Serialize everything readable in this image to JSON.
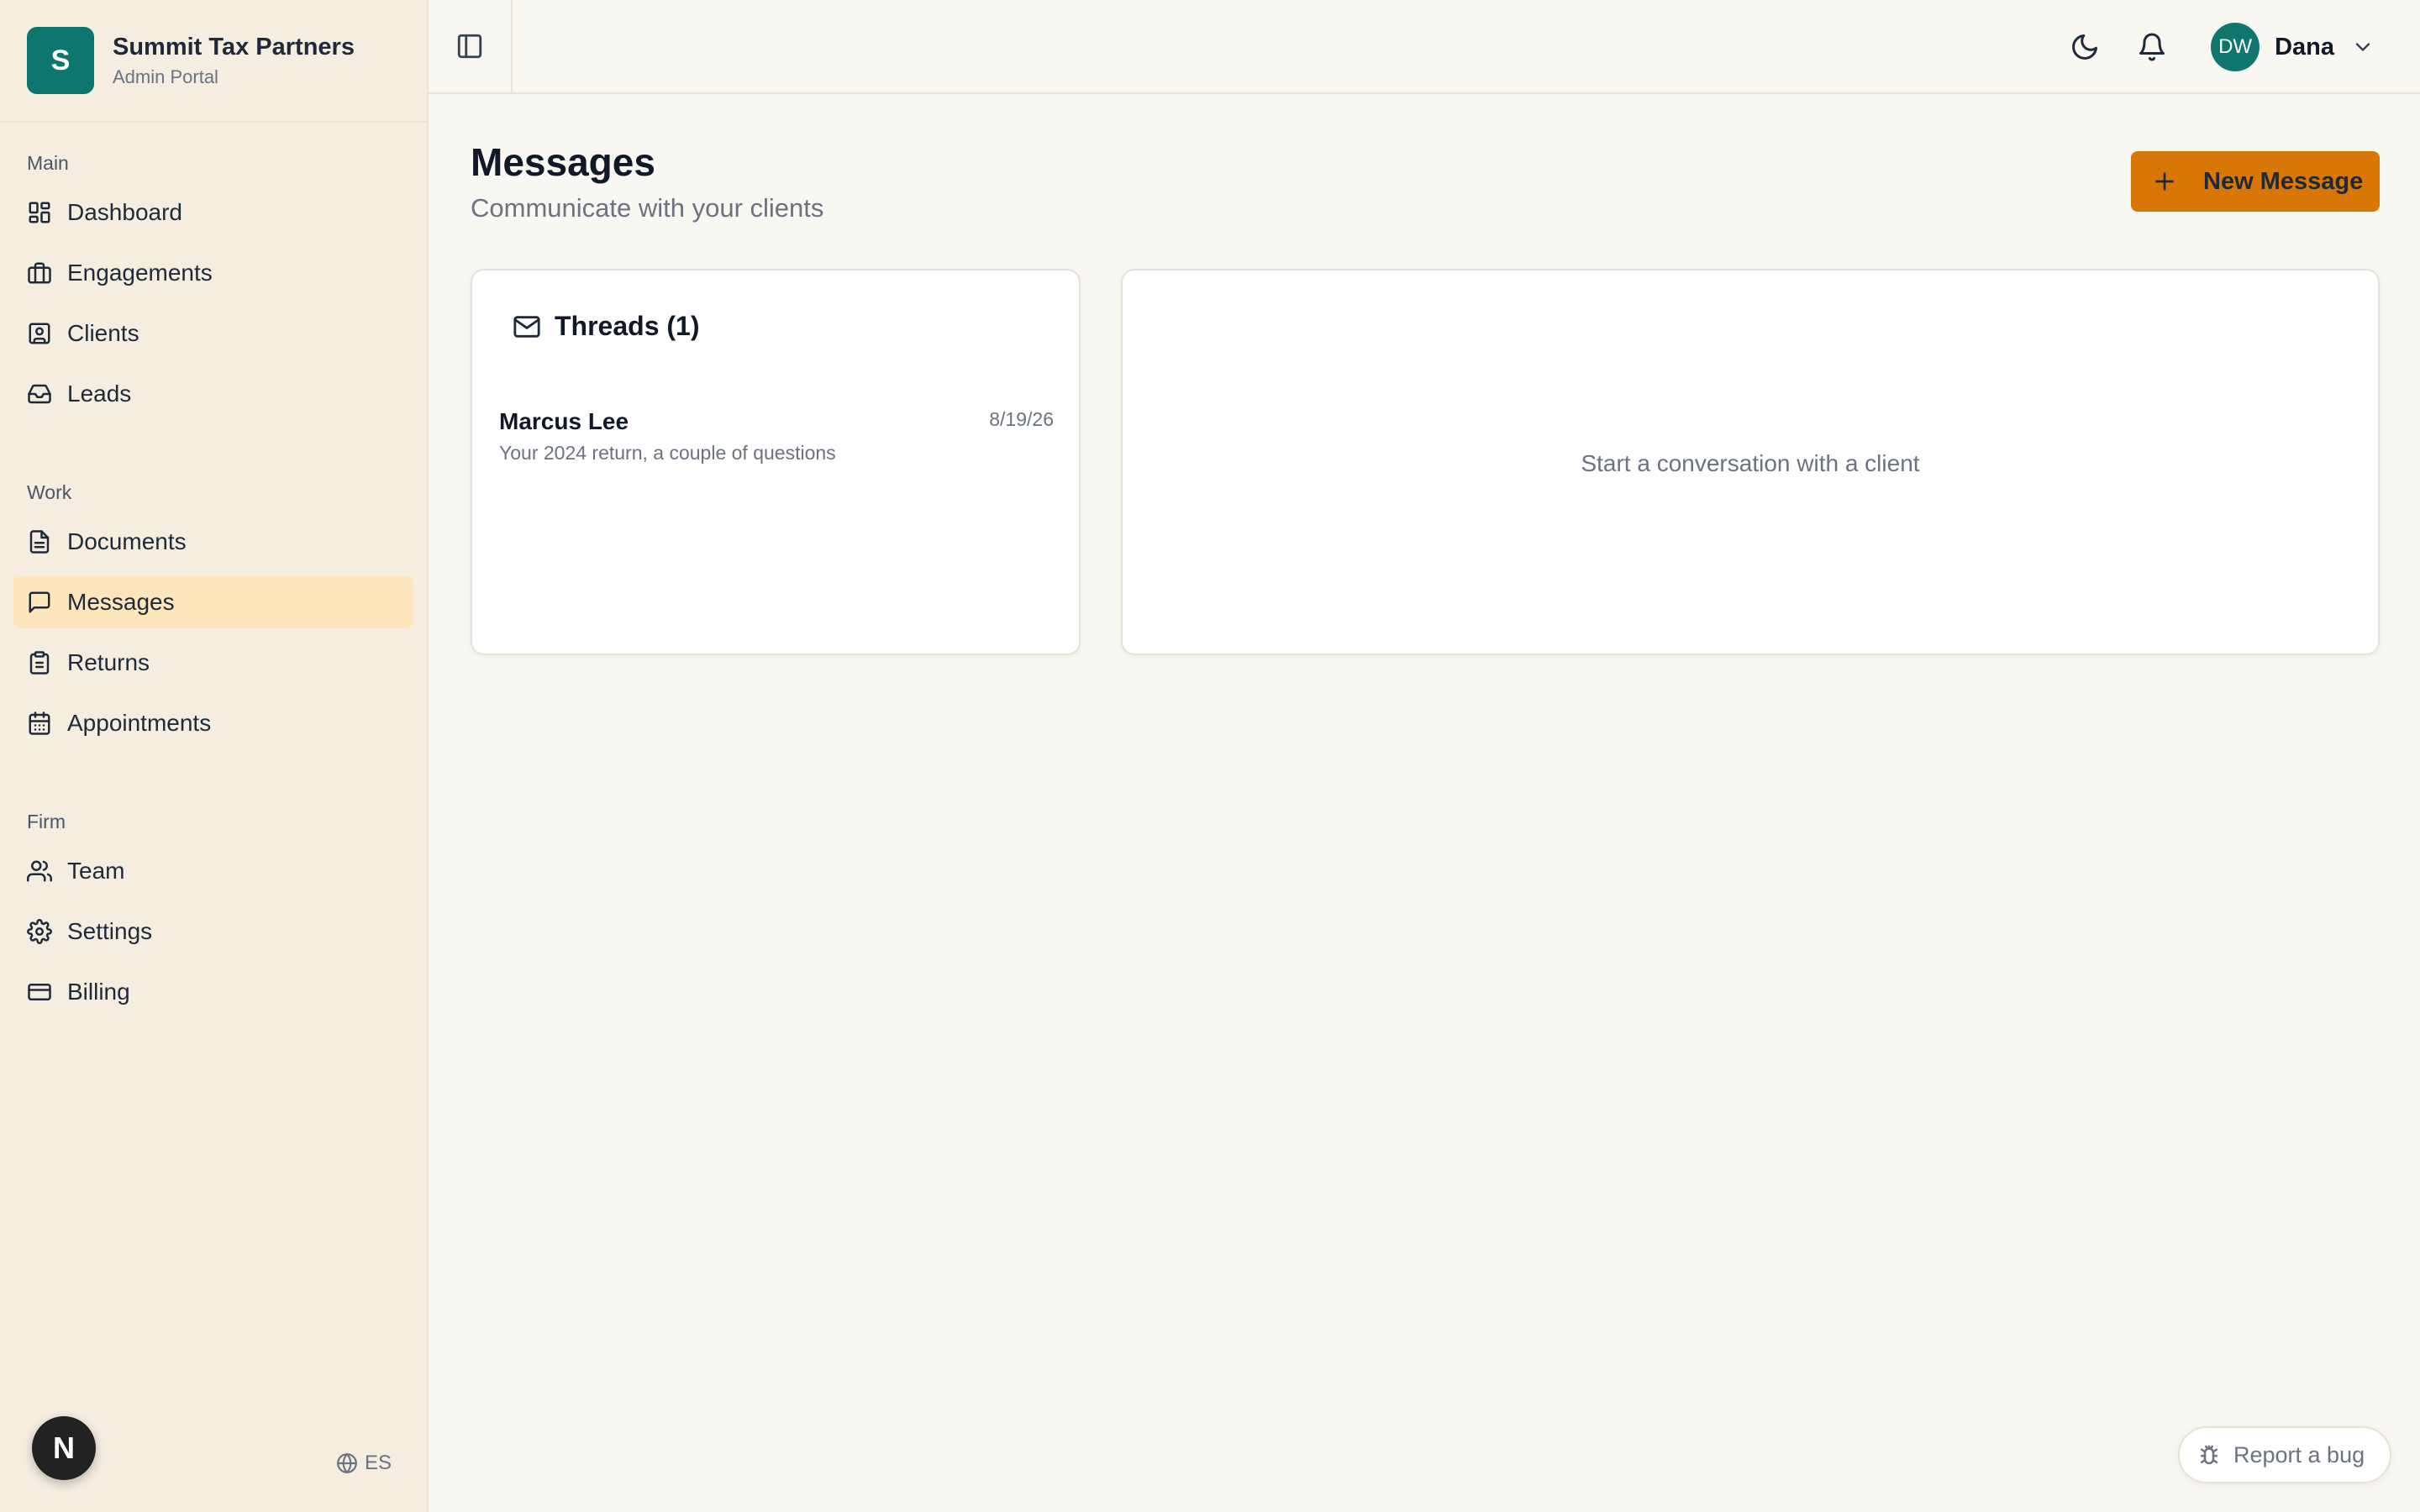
{
  "brand": {
    "initial": "S",
    "name": "Summit Tax Partners",
    "subtitle": "Admin Portal"
  },
  "sidebar": {
    "sections": [
      {
        "label": "Main",
        "items": [
          {
            "label": "Dashboard",
            "icon": "dashboard-icon"
          },
          {
            "label": "Engagements",
            "icon": "briefcase-icon"
          },
          {
            "label": "Clients",
            "icon": "contact-icon"
          },
          {
            "label": "Leads",
            "icon": "inbox-icon"
          }
        ]
      },
      {
        "label": "Work",
        "items": [
          {
            "label": "Documents",
            "icon": "document-icon"
          },
          {
            "label": "Messages",
            "icon": "message-icon",
            "active": true
          },
          {
            "label": "Returns",
            "icon": "clipboard-icon"
          },
          {
            "label": "Appointments",
            "icon": "calendar-icon"
          }
        ]
      },
      {
        "label": "Firm",
        "items": [
          {
            "label": "Team",
            "icon": "users-icon"
          },
          {
            "label": "Settings",
            "icon": "gear-icon"
          },
          {
            "label": "Billing",
            "icon": "credit-card-icon"
          }
        ]
      }
    ],
    "language": "ES",
    "dev_badge": "N"
  },
  "topbar": {
    "user_initials": "DW",
    "user_name": "Dana"
  },
  "main": {
    "title": "Messages",
    "subtitle": "Communicate with your clients",
    "new_button": "New Message",
    "threads": {
      "title": "Threads (1)",
      "items": [
        {
          "name": "Marcus Lee",
          "date": "8/19/26",
          "preview": "Your 2024 return, a couple of questions"
        }
      ]
    },
    "empty_state": "Start a conversation with a client"
  },
  "report_bug": "Report a bug",
  "colors": {
    "accent": "#d97706",
    "brand": "#0f766e",
    "active_nav": "#fde6bc",
    "sidebar_bg": "#f5ede0"
  }
}
